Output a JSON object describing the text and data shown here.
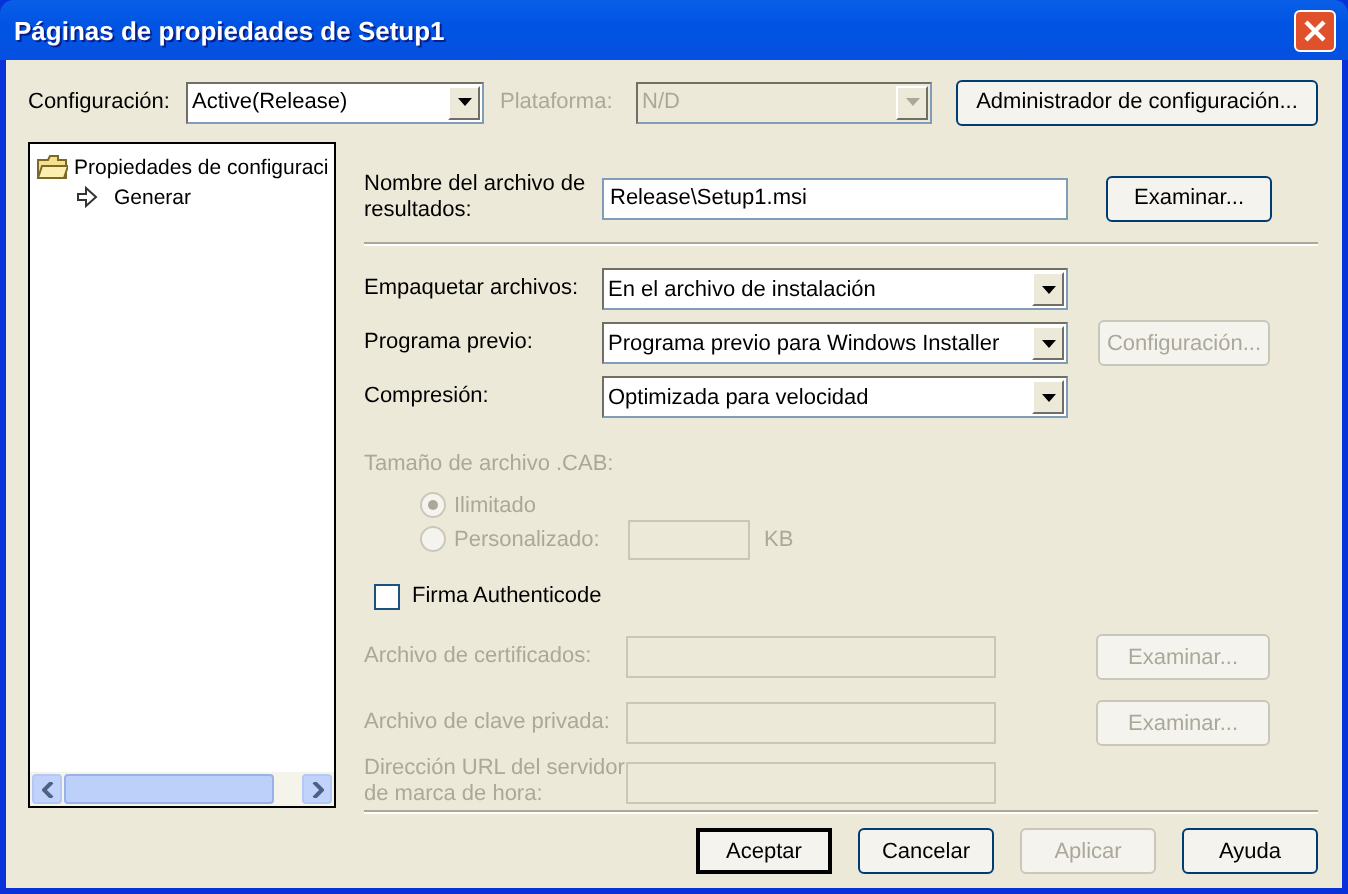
{
  "window": {
    "title": "Páginas de propiedades de Setup1"
  },
  "toolbar": {
    "configuration": {
      "label": "Configuración:",
      "value": "Active(Release)",
      "disabled": false
    },
    "platform": {
      "label": "Plataforma:",
      "value": "N/D",
      "disabled": true
    },
    "manager_button": {
      "label": "Administrador de configuración...",
      "disabled": false
    }
  },
  "tree": [
    {
      "label": "Propiedades de configuraci",
      "selected": false,
      "children": [
        {
          "label": "Generar",
          "selected": false
        }
      ]
    }
  ],
  "form": [
    {
      "kind": "file",
      "label": "Nombre del archivo de resultados:",
      "value": "Release\\Setup1.msi",
      "disabled": false,
      "button": {
        "label": "Examinar...",
        "disabled": false
      }
    },
    {
      "kind": "separator"
    },
    {
      "kind": "combo",
      "label": "Empaquetar archivos:",
      "value": "En el archivo de instalación",
      "disabled": false
    },
    {
      "kind": "combo",
      "label": "Programa previo:",
      "value": "Programa previo para Windows Installer",
      "disabled": false,
      "button": {
        "label": "Configuración...",
        "disabled": true
      }
    },
    {
      "kind": "combo",
      "label": "Compresión:",
      "value": "Optimizada para velocidad",
      "disabled": false
    },
    {
      "kind": "group",
      "label": "Tamaño de archivo .CAB:",
      "disabled": true
    },
    {
      "kind": "radio",
      "label": "Ilimitado",
      "selected": true,
      "disabled": true
    },
    {
      "kind": "radio",
      "label": "Personalizado:",
      "selected": false,
      "disabled": true,
      "unit": "KB"
    },
    {
      "kind": "checkbox",
      "label": "Firma Authenticode",
      "checked": false,
      "disabled": false
    },
    {
      "kind": "signing",
      "label": "Archivo de certificados:",
      "disabled": true,
      "button": {
        "label": "Examinar...",
        "disabled": true
      }
    },
    {
      "kind": "signing",
      "label": "Archivo de clave privada:",
      "disabled": true,
      "button": {
        "label": "Examinar...",
        "disabled": true
      }
    },
    {
      "kind": "signing",
      "label": "Dirección URL del servidor de marca de hora:",
      "disabled": true
    }
  ],
  "footer": [
    {
      "label": "Aceptar",
      "default": true,
      "disabled": false
    },
    {
      "label": "Cancelar",
      "default": false,
      "disabled": false
    },
    {
      "label": "Aplicar",
      "default": false,
      "disabled": true
    },
    {
      "label": "Ayuda",
      "default": false,
      "disabled": false
    }
  ]
}
